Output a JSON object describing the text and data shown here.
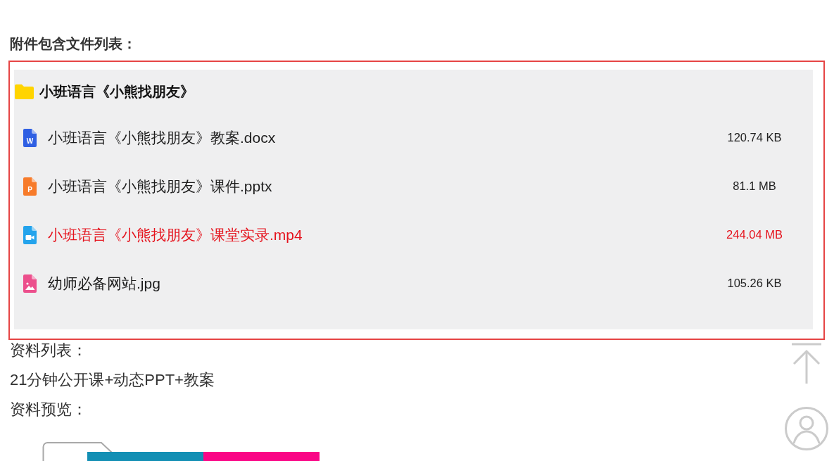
{
  "heading": "附件包含文件列表：",
  "attachment_panel": {
    "folder": {
      "name": "小班语言《小熊找朋友》"
    },
    "files": [
      {
        "kind": "doc",
        "icon_letter": "W",
        "name": "小班语言《小熊找朋友》教案.docx",
        "size": "120.74 KB",
        "selected": false
      },
      {
        "kind": "slides",
        "icon_letter": "P",
        "name": "小班语言《小熊找朋友》课件.pptx",
        "size": "81.1 MB",
        "selected": false
      },
      {
        "kind": "video",
        "name": "小班语言《小熊找朋友》课堂实录.mp4",
        "size": "244.04 MB",
        "selected": true
      },
      {
        "kind": "image",
        "name": "幼师必备网站.jpg",
        "size": "105.26 KB",
        "selected": false
      }
    ]
  },
  "material_list": {
    "label": "资料列表：",
    "content": "21分钟公开课+动态PPT+教案"
  },
  "preview": {
    "label": "资料预览："
  },
  "floating_buttons": [
    {
      "kind": "back-to-top"
    },
    {
      "kind": "profile"
    }
  ]
}
